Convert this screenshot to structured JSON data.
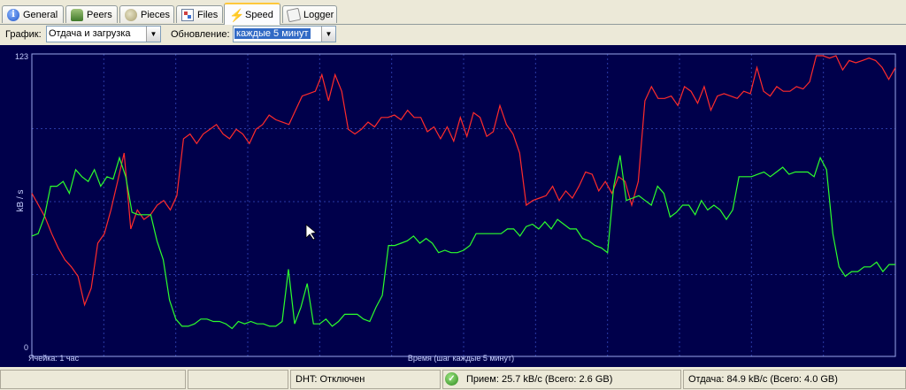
{
  "tabs": [
    {
      "label": "General",
      "icon": "info-icon"
    },
    {
      "label": "Peers",
      "icon": "peers-icon"
    },
    {
      "label": "Pieces",
      "icon": "pieces-icon"
    },
    {
      "label": "Files",
      "icon": "files-icon"
    },
    {
      "label": "Speed",
      "icon": "speed-icon",
      "active": true
    },
    {
      "label": "Logger",
      "icon": "logger-icon"
    }
  ],
  "toolbar": {
    "graph_label": "График:",
    "graph_value": "Отдача и загрузка",
    "update_label": "Обновление:",
    "update_value": "каждые 5 минут"
  },
  "chart_data": {
    "type": "line",
    "ylabel": "kB / s",
    "ylim": [
      0,
      123
    ],
    "y_tick_labels": [
      "0",
      "123"
    ],
    "cell_label": "Ячейка: 1 час",
    "xlabel": "Время (шаг каждые 5 минут)",
    "grid": true,
    "colors": {
      "background": "#00004b",
      "grid": "#2a3aa6",
      "upload": "#ff2b2b",
      "download": "#2cff2c"
    },
    "series": [
      {
        "values": [
          65,
          60,
          55,
          48,
          42,
          37,
          34,
          30,
          18,
          25,
          44,
          48,
          58,
          70,
          82,
          50,
          58,
          54,
          56,
          60,
          62,
          58,
          64,
          88,
          90,
          86,
          90,
          92,
          94,
          90,
          88,
          92,
          90,
          86,
          92,
          94,
          98,
          96,
          95,
          94,
          100,
          106,
          107,
          108,
          115,
          104,
          115,
          108,
          92,
          90,
          92,
          95,
          93,
          97,
          97,
          98,
          96,
          100,
          97,
          97,
          91,
          93,
          88,
          93,
          87,
          97,
          89,
          99,
          97,
          89,
          91,
          102,
          94,
          90,
          82,
          60,
          62,
          63,
          64,
          68,
          62,
          66,
          63,
          68,
          74,
          73,
          66,
          70,
          65,
          72,
          70,
          60,
          70,
          104,
          110,
          105,
          105,
          106,
          102,
          110,
          108,
          103,
          110,
          100,
          106,
          107,
          106,
          105,
          108,
          107,
          118,
          108,
          106,
          110,
          108,
          108,
          110,
          109,
          112,
          123,
          123,
          122,
          123,
          117,
          121,
          120,
          121,
          122,
          121,
          118,
          113,
          118
        ]
      },
      {
        "values": [
          47,
          48,
          55,
          68,
          68,
          70,
          65,
          75,
          72,
          70,
          75,
          68,
          72,
          71,
          80,
          72,
          57,
          56,
          56,
          56,
          45,
          37,
          20,
          12,
          9,
          9,
          10,
          12,
          12,
          11,
          11,
          10,
          8,
          11,
          10,
          11,
          10,
          10,
          9,
          9,
          11,
          33,
          10,
          17,
          27,
          10,
          10,
          12,
          9,
          11,
          14,
          14,
          14,
          12,
          11,
          17,
          22,
          43,
          43,
          44,
          45,
          47,
          44,
          46,
          44,
          40,
          41,
          40,
          40,
          41,
          43,
          48,
          48,
          48,
          48,
          48,
          50,
          50,
          47,
          51,
          52,
          50,
          53,
          50,
          54,
          52,
          50,
          50,
          46,
          45,
          43,
          42,
          40,
          68,
          81,
          62,
          63,
          64,
          62,
          60,
          68,
          65,
          55,
          57,
          60,
          60,
          56,
          62,
          58,
          60,
          58,
          54,
          58,
          72,
          72,
          72,
          73,
          74,
          72,
          74,
          76,
          73,
          74,
          74,
          74,
          72,
          80,
          75,
          48,
          34,
          30,
          32,
          32,
          34,
          34,
          36,
          32,
          35,
          35
        ]
      }
    ]
  },
  "status": {
    "empty1": "",
    "empty2": "",
    "dht": "DHT: Отключен",
    "download": "Прием: 25.7 kB/c (Всего: 2.6 GB)",
    "upload": "Отдача: 84.9 kB/c (Всего: 4.0 GB)"
  }
}
